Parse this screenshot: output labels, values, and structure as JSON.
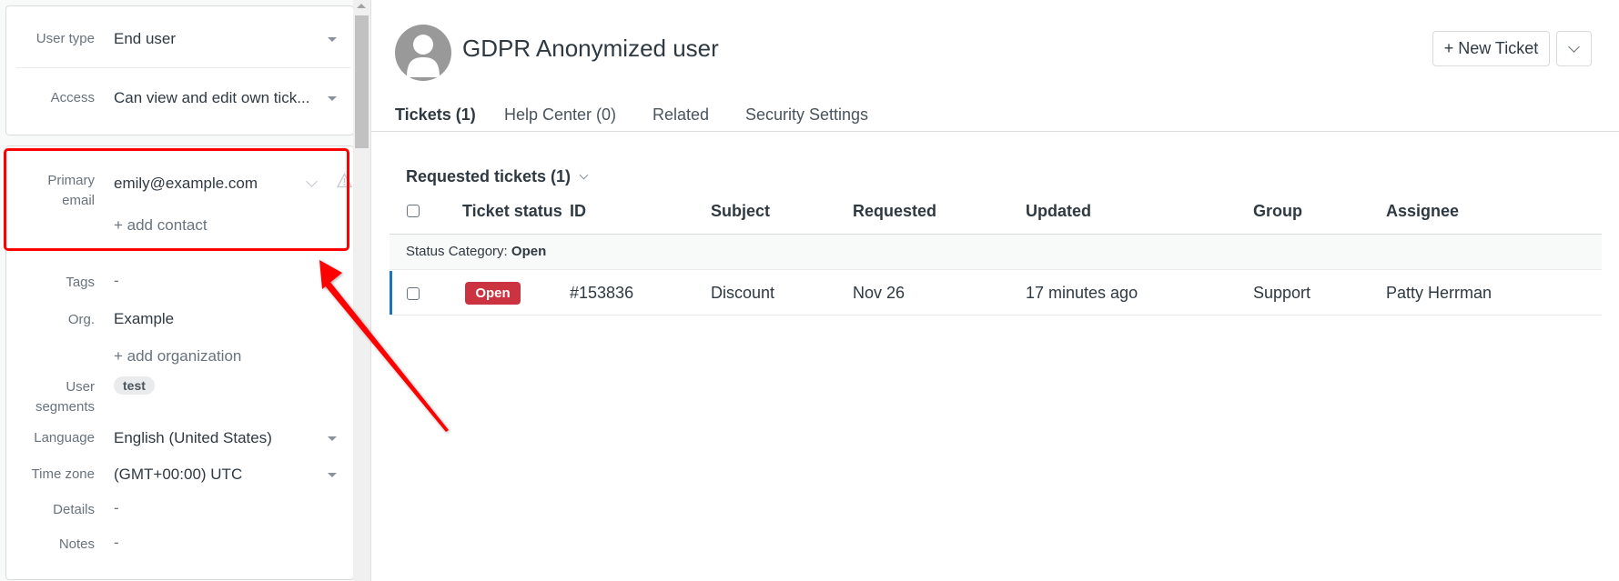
{
  "sidebar": {
    "user_type": {
      "label": "User type",
      "value": "End user"
    },
    "access": {
      "label": "Access",
      "value": "Can view and edit own tick..."
    },
    "primary_email": {
      "label_line1": "Primary",
      "label_line2": "email",
      "value": "emily@example.com",
      "add_contact": "+ add contact"
    },
    "tags": {
      "label": "Tags",
      "value": "-"
    },
    "org": {
      "label": "Org.",
      "value": "Example",
      "add_org": "+ add organization"
    },
    "user_segments": {
      "label_line1": "User",
      "label_line2": "segments",
      "tag": "test"
    },
    "language": {
      "label": "Language",
      "value": "English (United States)"
    },
    "time_zone": {
      "label": "Time zone",
      "value": "(GMT+00:00) UTC"
    },
    "details": {
      "label": "Details",
      "value": "-"
    },
    "notes": {
      "label": "Notes",
      "value": "-"
    }
  },
  "header": {
    "title": "GDPR Anonymized user",
    "new_ticket_label": "+ New Ticket"
  },
  "tabs": [
    {
      "label": "Tickets (1)",
      "active": true
    },
    {
      "label": "Help Center (0)",
      "active": false
    },
    {
      "label": "Related",
      "active": false
    },
    {
      "label": "Security Settings",
      "active": false
    }
  ],
  "tickets": {
    "section_title": "Requested tickets (1)",
    "columns": [
      "Ticket status",
      "ID",
      "Subject",
      "Requested",
      "Updated",
      "Group",
      "Assignee"
    ],
    "group_label_prefix": "Status Category: ",
    "group_label_value": "Open",
    "rows": [
      {
        "status": "Open",
        "id": "#153836",
        "subject": "Discount",
        "requested": "Nov 26",
        "updated": "17 minutes ago",
        "group": "Support",
        "assignee": "Patty Herrman"
      }
    ]
  },
  "colors": {
    "status_open": "#cc3340",
    "accent": "#1f73b7",
    "annotation": "#ff0000"
  }
}
